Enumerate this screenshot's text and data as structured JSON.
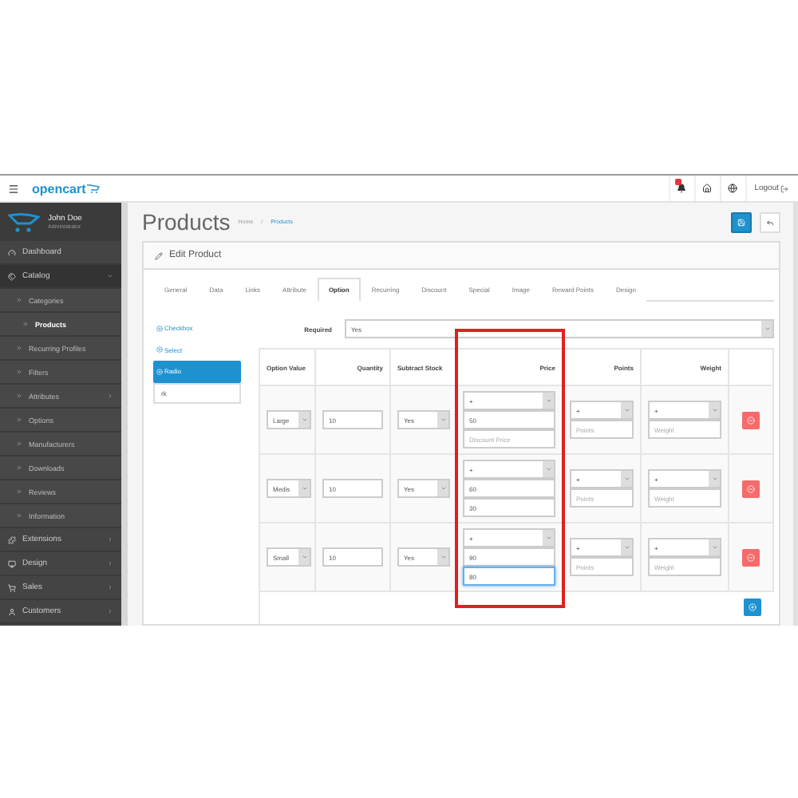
{
  "header": {
    "logo": "opencart",
    "logout": "Logout"
  },
  "user": {
    "name": "John Doe",
    "role": "Administrator"
  },
  "sidebar": [
    {
      "label": "Dashboard"
    },
    {
      "label": "Catalog",
      "expanded": true,
      "children": [
        {
          "label": "Categories",
          "selected": false
        },
        {
          "label": "Products",
          "selected": true
        },
        {
          "label": "Recurring Profiles",
          "selected": false
        },
        {
          "label": "Filters",
          "selected": false
        },
        {
          "label": "Attributes",
          "selected": false,
          "expanded": false
        },
        {
          "label": "Options",
          "selected": false
        },
        {
          "label": "Manufacturers",
          "selected": false
        },
        {
          "label": "Downloads",
          "selected": false
        },
        {
          "label": "Reviews",
          "selected": false
        },
        {
          "label": "Information",
          "selected": false
        }
      ]
    },
    {
      "label": "Extensions",
      "expanded": false
    },
    {
      "label": "Design",
      "expanded": false
    },
    {
      "label": "Sales",
      "expanded": false
    },
    {
      "label": "Customers",
      "expanded": false
    }
  ],
  "page": {
    "title": "Products",
    "breadcrumb": [
      "Home",
      "Products"
    ],
    "breadcrumb_separator": "/"
  },
  "panel_title": "Edit Product",
  "tabs": [
    {
      "label": "General",
      "selected": false
    },
    {
      "label": "Data",
      "selected": false
    },
    {
      "label": "Links",
      "selected": false
    },
    {
      "label": "Attribute",
      "selected": false
    },
    {
      "label": "Option",
      "selected": true
    },
    {
      "label": "Recurring",
      "selected": false
    },
    {
      "label": "Discount",
      "selected": false
    },
    {
      "label": "Special",
      "selected": false
    },
    {
      "label": "Image",
      "selected": false
    },
    {
      "label": "Reward Points",
      "selected": false
    },
    {
      "label": "Design",
      "selected": false
    }
  ],
  "option_list": [
    {
      "label": "Checkbox",
      "selected": false
    },
    {
      "label": "Select",
      "selected": false
    },
    {
      "label": "Radio",
      "selected": true
    }
  ],
  "option_search": {
    "value": "rk"
  },
  "required": {
    "label": "Required",
    "value": "Yes"
  },
  "table": {
    "columns": [
      {
        "label": "Option Value",
        "highlighted": false
      },
      {
        "label": "Quantity",
        "highlighted": false
      },
      {
        "label": "Subtract Stock",
        "highlighted": false
      },
      {
        "label": "Price",
        "highlighted": true
      },
      {
        "label": "Points",
        "highlighted": false
      },
      {
        "label": "Weight",
        "highlighted": false
      }
    ],
    "rows": [
      {
        "option_value": "Large",
        "quantity": "10",
        "subtract": "Yes",
        "price_prefix": "+",
        "price": "50",
        "discount_price": {
          "placeholder": "Discount Price",
          "focused": false
        },
        "points": {
          "prefix": "+",
          "placeholder": "Points"
        },
        "weight": {
          "prefix": "+",
          "placeholder": "Weight"
        }
      },
      {
        "option_value": "Medis",
        "quantity": "10",
        "subtract": "Yes",
        "price_prefix": "+",
        "price": "60",
        "discount_price": {
          "value": "30",
          "focused": false
        },
        "points": {
          "prefix": "+",
          "placeholder": "Points"
        },
        "weight": {
          "prefix": "+",
          "placeholder": "Weight"
        }
      },
      {
        "option_value": "Small",
        "quantity": "10",
        "subtract": "Yes",
        "price_prefix": "+",
        "price": "90",
        "discount_price": {
          "value": "80",
          "focused": true
        },
        "points": {
          "prefix": "+",
          "placeholder": "Points"
        },
        "weight": {
          "prefix": "+",
          "placeholder": "Weight"
        }
      }
    ]
  }
}
